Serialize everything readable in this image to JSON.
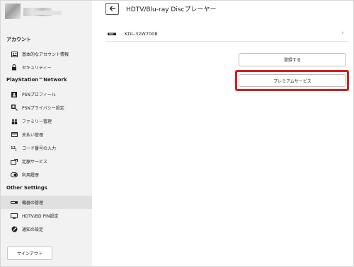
{
  "sidebar": {
    "sections": [
      {
        "title": "アカウント"
      },
      {
        "title": "PlayStation™Network"
      },
      {
        "title": "Other Settings"
      }
    ],
    "items": [
      {
        "label": "基本的なアカウント情報",
        "icon": "id-card-icon"
      },
      {
        "label": "セキュリティー",
        "icon": "lock-icon"
      },
      {
        "label": "PSNプロフィール",
        "icon": "profile-icon"
      },
      {
        "label": "PSNプライバシー設定",
        "icon": "privacy-icon"
      },
      {
        "label": "ファミリー管理",
        "icon": "family-icon"
      },
      {
        "label": "支払い管理",
        "icon": "credit-card-icon"
      },
      {
        "label": "コード番号の入力",
        "icon": "code-number-icon"
      },
      {
        "label": "定額サービス",
        "icon": "subscription-icon"
      },
      {
        "label": "利用履歴",
        "icon": "history-icon"
      },
      {
        "label": "機器の管理",
        "icon": "devices-icon"
      },
      {
        "label": "HDTV/BD PIN設定",
        "icon": "monitor-icon"
      },
      {
        "label": "通知の設定",
        "icon": "notification-icon"
      }
    ],
    "active_item": "機器の管理",
    "signout_label": "サインアウト"
  },
  "main": {
    "title": "HDTV/Blu-ray Discプレーヤー",
    "device_name": "KDL-32W700B",
    "register_label": "登録する",
    "premium_label": "プレミアムサービス"
  },
  "colors": {
    "sidebar_bg": "#f2f2f2",
    "active_bg": "#e0e0e0",
    "highlight": "#d02020"
  }
}
